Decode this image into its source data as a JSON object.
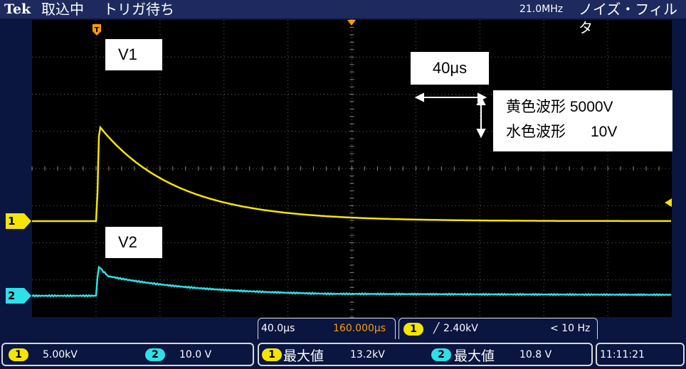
{
  "header": {
    "brand": "Tek",
    "acquisition_status": "取込中",
    "trigger_status": "トリガ待ち",
    "bandwidth": "21.0MHz",
    "filter_label": "ノイズ・フィルタ"
  },
  "annotations": {
    "v1_label": "V1",
    "v2_label": "V2",
    "time_scale": "40μs",
    "legend_yellow": "黄色波形 5000V",
    "legend_cyan": "水色波形      10V"
  },
  "markers": {
    "ch1": "1",
    "ch2": "2"
  },
  "status": {
    "timebase": "40.0μs",
    "position": "160.000μs",
    "trigger_channel": "1",
    "trigger_level": "2.40kV",
    "trigger_freq": "< 10 Hz"
  },
  "footer": {
    "ch1_badge": "1",
    "ch1_scale": "5.00kV",
    "ch2_badge": "2",
    "ch2_scale": "10.0 V",
    "m1_badge": "1",
    "m1_label": "最大値",
    "m1_value": "13.2kV",
    "m2_badge": "2",
    "m2_label": "最大値",
    "m2_value": "10.8 V",
    "time": "11:11:21"
  },
  "colors": {
    "ch1": "#f5e600",
    "ch2": "#2ee0e8",
    "background": "#000000",
    "frame": "#0a1540",
    "marker": "#ff9d00"
  },
  "waveforms": {
    "ch1": {
      "peak_kv": 13.2,
      "decay_tau_us": 48,
      "baseline_kv": 0
    },
    "ch2": {
      "peak_v": 10.8,
      "decay_tau_us": 60,
      "baseline_v": 0
    }
  }
}
